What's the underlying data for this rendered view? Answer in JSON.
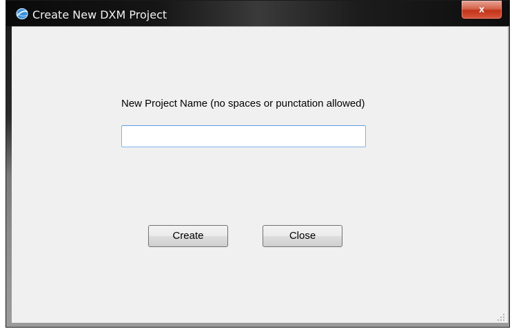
{
  "window": {
    "title": "Create New DXM Project",
    "close_label": "x",
    "icon": "globe-icon"
  },
  "form": {
    "name_label": "New Project Name (no spaces or punctation allowed)",
    "name_value": "",
    "name_placeholder": ""
  },
  "buttons": {
    "create_label": "Create",
    "close_label": "Close"
  },
  "colors": {
    "title_bar": "#151515",
    "close_button": "#c2351a",
    "client_bg": "#f0f0f0",
    "input_border": "#7eb4ea"
  }
}
